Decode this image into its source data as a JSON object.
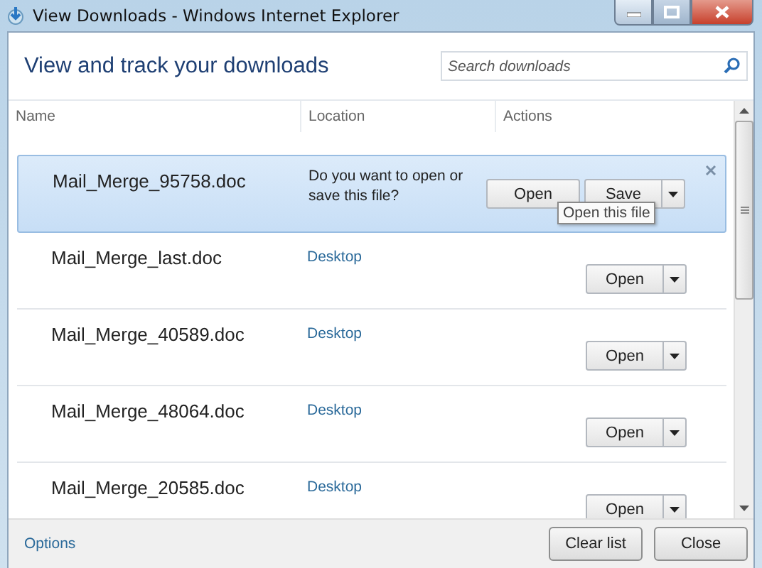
{
  "window": {
    "title": "View Downloads - Windows Internet Explorer"
  },
  "heading": "View and track your downloads",
  "search": {
    "placeholder": "Search downloads"
  },
  "columns": [
    "Name",
    "Location",
    "Actions"
  ],
  "rows": [
    {
      "kind": "prompt",
      "name": "Mail_Merge_95758.doc",
      "location": "Do you want to open or save this file?",
      "selected": true,
      "buttons": [
        "Open",
        "Save"
      ],
      "tooltip": "Open this file"
    },
    {
      "kind": "done",
      "name": "Mail_Merge_last.doc",
      "location": "Desktop",
      "selected": false,
      "buttons": [
        "Open"
      ]
    },
    {
      "kind": "done",
      "name": "Mail_Merge_40589.doc",
      "location": "Desktop",
      "selected": false,
      "buttons": [
        "Open"
      ]
    },
    {
      "kind": "done",
      "name": "Mail_Merge_48064.doc",
      "location": "Desktop",
      "selected": false,
      "buttons": [
        "Open"
      ]
    },
    {
      "kind": "done",
      "name": "Mail_Merge_20585.doc",
      "location": "Desktop",
      "selected": false,
      "buttons": [
        "Open"
      ]
    }
  ],
  "footer": {
    "link": "Options",
    "buttons": [
      "Clear list",
      "Close"
    ]
  }
}
